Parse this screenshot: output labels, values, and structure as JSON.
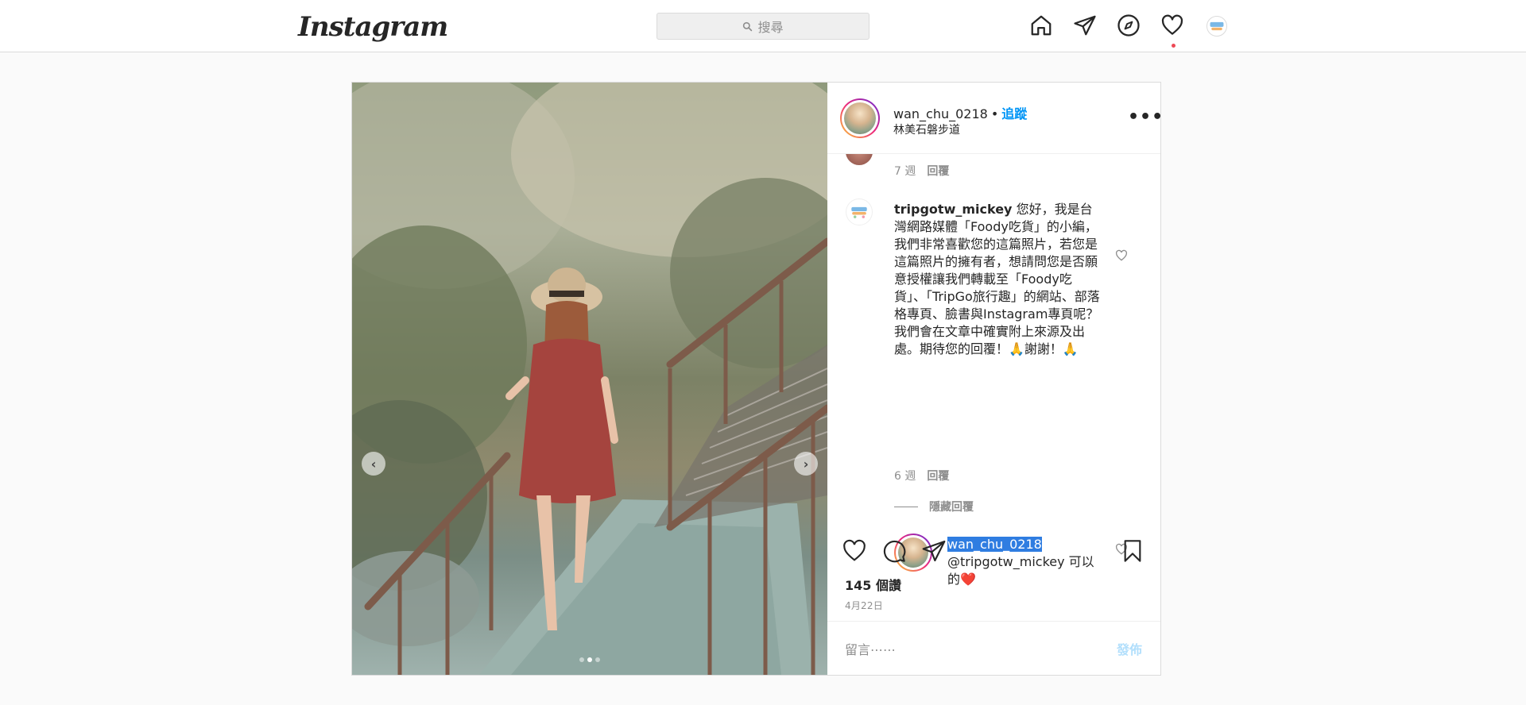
{
  "topbar": {
    "logo": "Instagram",
    "search_placeholder": "搜尋",
    "icons": [
      "home-icon",
      "direct-message-icon",
      "explore-icon",
      "activity-heart-icon",
      "profile-avatar"
    ]
  },
  "post": {
    "author": "wan_chu_0218",
    "separator": "•",
    "follow_label": "追蹤",
    "location": "林美石磐步道",
    "more_label": "•••",
    "comments": [
      {
        "time": "7 週",
        "reply_label": "回覆"
      },
      {
        "user": "tripgotw_mickey",
        "text": " 您好，我是台灣網路媒體「Foody吃貨」的小編，我們非常喜歡您的這篇照片，若您是這篇照片的擁有者，想請問您是否願意授權讓我們轉載至「Foody吃貨」、「TripGo旅行趣」的網站、部落格專頁、臉書與Instagram專頁呢？我們會在文章中確實附上來源及出處。期待您的回覆！🙏謝謝！🙏",
        "time": "6 週",
        "reply_label": "回覆"
      }
    ],
    "hide_replies_label": "隱藏回覆",
    "reply": {
      "user": "wan_chu_0218",
      "mention": "@tripgotw_mickey",
      "text": " 可以的❤️"
    },
    "likes": "145 個讚",
    "date": "4月22日",
    "comment_placeholder": "留言⋯⋯",
    "post_button": "發佈"
  },
  "colors": {
    "accent": "#0095f6",
    "notification_dot": "#ed4956",
    "post_button_disabled": "#b2dffc",
    "highlight": "#2f7de1"
  }
}
